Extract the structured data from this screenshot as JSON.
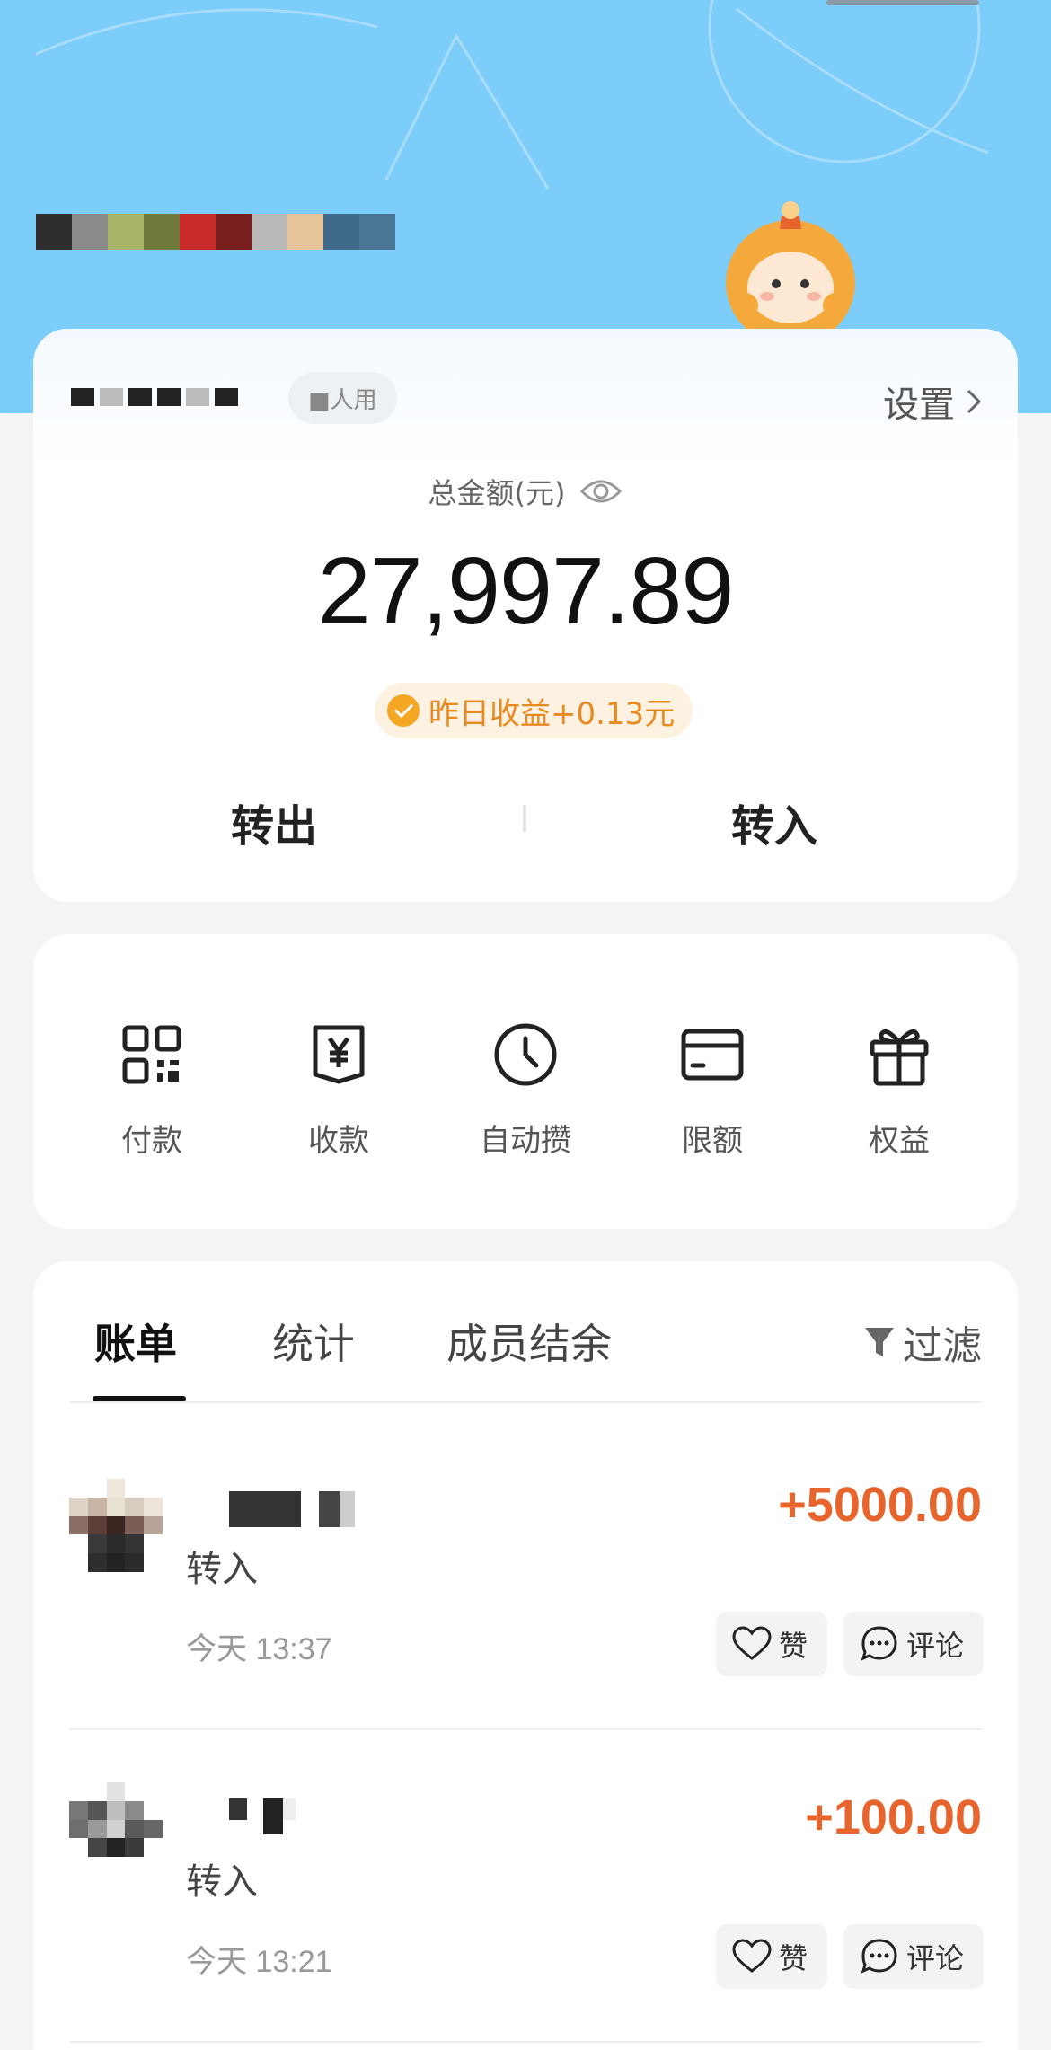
{
  "account": {
    "tag": "■人用",
    "settings_label": "设置"
  },
  "balance": {
    "label": "总金额(元)",
    "amount": "27,997.89",
    "yesterday": "昨日收益+0.13元"
  },
  "transfer": {
    "out_label": "转出",
    "in_label": "转入"
  },
  "actions": [
    {
      "label": "付款",
      "icon": "qr-code-icon"
    },
    {
      "label": "收款",
      "icon": "yen-receipt-icon"
    },
    {
      "label": "自动攒",
      "icon": "clock-icon"
    },
    {
      "label": "限额",
      "icon": "card-icon"
    },
    {
      "label": "权益",
      "icon": "gift-icon"
    }
  ],
  "tabs": [
    {
      "label": "账单",
      "active": true
    },
    {
      "label": "统计",
      "active": false
    },
    {
      "label": "成员结余",
      "active": false
    }
  ],
  "filter_label": "过滤",
  "transactions": [
    {
      "type": "转入",
      "amount": "+5000.00",
      "time": "今天 13:37",
      "like_label": "赞",
      "comment_label": "评论"
    },
    {
      "type": "转入",
      "amount": "+100.00",
      "time": "今天 13:21",
      "like_label": "赞",
      "comment_label": "评论"
    }
  ],
  "colors": {
    "hero": "#7ccdfa",
    "amount_positive": "#e7642d",
    "earnings": "#e88a20"
  }
}
